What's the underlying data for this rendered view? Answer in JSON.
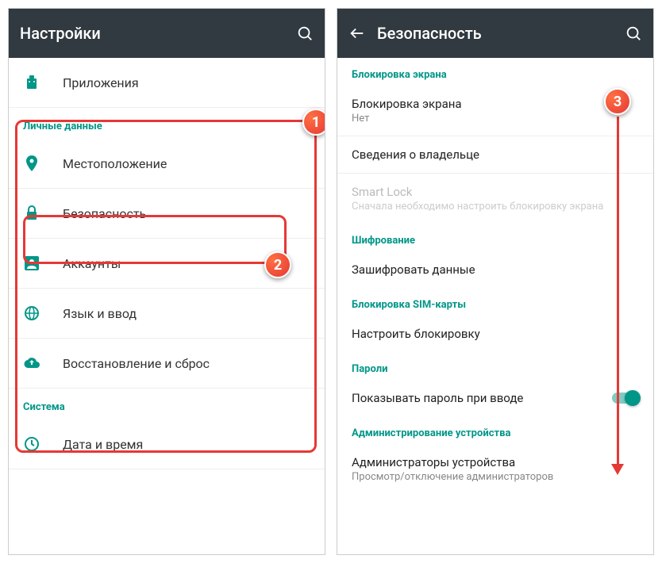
{
  "left": {
    "title": "Настройки",
    "top_item": "Приложения",
    "section_personal": "Личные данные",
    "items": [
      "Местоположение",
      "Безопасность",
      "Аккаунты",
      "Язык и ввод",
      "Восстановление и сброс"
    ],
    "section_system": "Система",
    "system_item": "Дата и время"
  },
  "right": {
    "title": "Безопасность",
    "section_screenlock": "Блокировка экрана",
    "screenlock_label": "Блокировка экрана",
    "screenlock_value": "Нет",
    "owner_info": "Сведения о владельце",
    "smartlock_label": "Smart Lock",
    "smartlock_note": "Сначала необходимо настроить блокировку экрана",
    "section_encryption": "Шифрование",
    "encrypt_label": "Зашифровать данные",
    "section_sim": "Блокировка SIM-карты",
    "sim_label": "Настроить блокировку",
    "section_passwords": "Пароли",
    "show_password": "Показывать пароль при вводе",
    "section_admin": "Администрирование устройства",
    "admin_label": "Администраторы устройства",
    "admin_subtitle": "Просмотр/отключение администраторов"
  },
  "markers": {
    "m1": "1",
    "m2": "2",
    "m3": "3"
  }
}
